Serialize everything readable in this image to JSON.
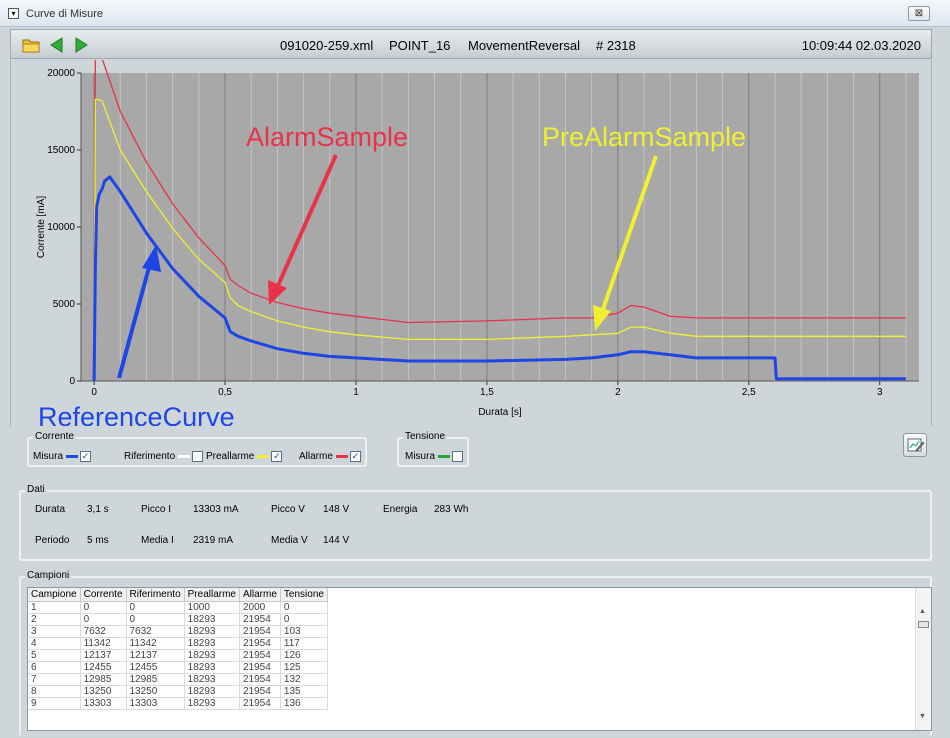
{
  "window": {
    "title": "Curve di Misure",
    "close_glyph": "⊠"
  },
  "toolbar": {
    "file": "091020-259.xml",
    "point": "POINT_16",
    "movement": "MovementReversal",
    "number": "# 2318",
    "datetime": "10:09:44 02.03.2020",
    "icons": [
      "folder-icon",
      "arrow-left-icon",
      "arrow-right-icon"
    ]
  },
  "chart_data": {
    "type": "line",
    "xlabel": "Durata [s]",
    "ylabel": "Corrente [mA]",
    "xlim": [
      -0.05,
      3.15
    ],
    "ylim": [
      0,
      20000
    ],
    "x_ticks": [
      0,
      0.5,
      1,
      1.5,
      2,
      2.5,
      3
    ],
    "x_tick_labels": [
      "0",
      "0,5",
      "1",
      "1,5",
      "2",
      "2,5",
      "3"
    ],
    "y_ticks": [
      0,
      5000,
      10000,
      15000,
      20000
    ],
    "y_tick_labels": [
      "0",
      "5000",
      "10000",
      "15000",
      "20000"
    ],
    "grid": "vertical",
    "series": [
      {
        "key": "allarme",
        "color": "#e8324a",
        "x": [
          0,
          0.005,
          0.01,
          0.1,
          0.2,
          0.3,
          0.4,
          0.5,
          0.52,
          0.55,
          0.6,
          0.7,
          0.8,
          0.9,
          1.0,
          1.2,
          1.5,
          1.8,
          1.9,
          2.0,
          2.05,
          2.1,
          2.2,
          2.3,
          2.5,
          2.6,
          3.1
        ],
        "y": [
          2000,
          21954,
          21954,
          17500,
          14200,
          11500,
          9300,
          7500,
          6600,
          6200,
          5700,
          5100,
          4700,
          4400,
          4200,
          3800,
          3900,
          4100,
          4100,
          4400,
          4900,
          4800,
          4200,
          4100,
          4100,
          4100,
          4100
        ]
      },
      {
        "key": "preallarme",
        "color": "#f0f030",
        "x": [
          0,
          0.005,
          0.01,
          0.03,
          0.1,
          0.2,
          0.3,
          0.4,
          0.5,
          0.52,
          0.55,
          0.6,
          0.7,
          0.8,
          0.9,
          1.0,
          1.2,
          1.5,
          1.8,
          2.0,
          2.05,
          2.1,
          2.2,
          2.3,
          2.5,
          3.1
        ],
        "y": [
          1000,
          18293,
          18293,
          18200,
          15000,
          12300,
          9900,
          7900,
          6400,
          5400,
          4900,
          4500,
          3900,
          3500,
          3200,
          3000,
          2700,
          2700,
          2900,
          3100,
          3500,
          3500,
          3100,
          2900,
          2900,
          2900
        ]
      },
      {
        "key": "riferimento",
        "color": "#ffffff",
        "x": [
          0,
          0.005,
          0.01,
          0.02,
          0.03,
          0.04,
          0.06,
          0.1,
          0.2,
          0.3,
          0.4,
          0.5,
          0.52,
          0.55,
          0.6,
          0.7,
          0.8,
          0.9,
          1.0,
          1.2,
          1.5,
          1.8,
          1.9,
          2.0,
          2.05,
          2.1,
          2.2,
          2.3,
          2.5,
          2.6,
          2.605,
          3.1
        ],
        "y": [
          0,
          7632,
          11342,
          12137,
          12455,
          12985,
          13250,
          12300,
          9600,
          7300,
          5500,
          4100,
          3200,
          2900,
          2600,
          2100,
          1800,
          1600,
          1500,
          1300,
          1300,
          1400,
          1500,
          1700,
          1900,
          1900,
          1700,
          1500,
          1500,
          1500,
          150,
          150
        ]
      },
      {
        "key": "misura",
        "color": "#1e46e6",
        "x": [
          0,
          0.005,
          0.01,
          0.02,
          0.03,
          0.04,
          0.06,
          0.1,
          0.2,
          0.3,
          0.4,
          0.5,
          0.52,
          0.55,
          0.6,
          0.7,
          0.8,
          0.9,
          1.0,
          1.2,
          1.5,
          1.8,
          1.9,
          2.0,
          2.05,
          2.1,
          2.2,
          2.3,
          2.5,
          2.6,
          2.605,
          3.1
        ],
        "y": [
          0,
          7632,
          11342,
          12137,
          12455,
          12985,
          13250,
          12300,
          9600,
          7300,
          5500,
          4100,
          3200,
          2900,
          2600,
          2100,
          1800,
          1600,
          1500,
          1300,
          1300,
          1400,
          1500,
          1700,
          1900,
          1900,
          1700,
          1500,
          1500,
          1500,
          150,
          150
        ]
      }
    ],
    "annotations": [
      {
        "text": "AlarmSample",
        "color": "#e8324a"
      },
      {
        "text": "PreAlarmSample",
        "color": "#f0f030"
      },
      {
        "text": "ReferenceCurve",
        "color": "#1e46e6"
      }
    ]
  },
  "corrente": {
    "title": "Corrente",
    "items": [
      {
        "label": "Misura",
        "color": "#1e46e6",
        "checked": "✓"
      },
      {
        "label": "Riferimento",
        "color": "#ffffff",
        "checked": ""
      },
      {
        "label": "Preallarme",
        "color": "#f0f030",
        "checked": "✓"
      },
      {
        "label": "Allarme",
        "color": "#e8324a",
        "checked": "✓"
      }
    ]
  },
  "tensione": {
    "title": "Tensione",
    "items": [
      {
        "label": "Misura",
        "color": "#22a83a",
        "checked": ""
      }
    ]
  },
  "edit_icon": "edit-chart-icon",
  "dati": {
    "title": "Dati",
    "durata_label": "Durata",
    "durata_value": "3,1 s",
    "periodo_label": "Periodo",
    "periodo_value": "5 ms",
    "picco_i_label": "Picco I",
    "picco_i_value": "13303 mA",
    "media_i_label": "Media I",
    "media_i_value": "2319 mA",
    "picco_v_label": "Picco V",
    "picco_v_value": "148 V",
    "media_v_label": "Media V",
    "media_v_value": "144 V",
    "energia_label": "Energia",
    "energia_value": "283 Wh"
  },
  "campioni": {
    "title": "Campioni",
    "columns": [
      "Campione",
      "Corrente",
      "Riferimento",
      "Preallarme",
      "Allarme",
      "Tensione"
    ],
    "rows": [
      [
        "1",
        "0",
        "0",
        "1000",
        "2000",
        "0"
      ],
      [
        "2",
        "0",
        "0",
        "18293",
        "21954",
        "0"
      ],
      [
        "3",
        "7632",
        "7632",
        "18293",
        "21954",
        "103"
      ],
      [
        "4",
        "11342",
        "11342",
        "18293",
        "21954",
        "117"
      ],
      [
        "5",
        "12137",
        "12137",
        "18293",
        "21954",
        "126"
      ],
      [
        "6",
        "12455",
        "12455",
        "18293",
        "21954",
        "125"
      ],
      [
        "7",
        "12985",
        "12985",
        "18293",
        "21954",
        "132"
      ],
      [
        "8",
        "13250",
        "13250",
        "18293",
        "21954",
        "135"
      ],
      [
        "9",
        "13303",
        "13303",
        "18293",
        "21954",
        "136"
      ]
    ]
  }
}
